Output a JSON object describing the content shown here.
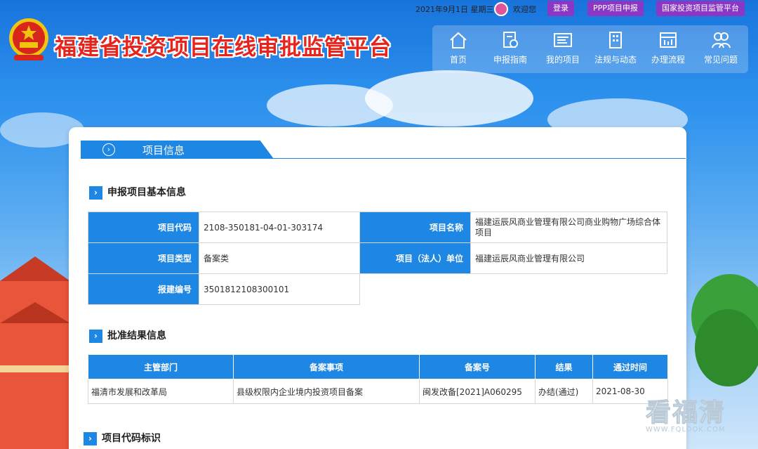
{
  "header": {
    "site_title": "福建省投资项目在线审批监管平台",
    "date_text": "2021年9月1日 星期三",
    "welcome": "欢迎您",
    "login_label": "登录",
    "ppp_label": "PPP项目申报",
    "national_label": "国家投资项目监管平台",
    "nav": [
      {
        "label": "首页",
        "icon": "home-icon"
      },
      {
        "label": "申报指南",
        "icon": "guide-icon"
      },
      {
        "label": "我的项目",
        "icon": "project-icon"
      },
      {
        "label": "法规与动态",
        "icon": "building-icon"
      },
      {
        "label": "办理流程",
        "icon": "process-icon"
      },
      {
        "label": "常见问题",
        "icon": "faq-icon"
      }
    ]
  },
  "panel": {
    "tab_title": "项目信息",
    "basic_section": "申报项目基本信息",
    "basic": {
      "code_label": "项目代码",
      "code_value": "2108-350181-04-01-303174",
      "name_label": "项目名称",
      "name_value": "福建运辰风商业管理有限公司商业购物广场综合体项目",
      "type_label": "项目类型",
      "type_value": "备案类",
      "unit_label": "项目（法人）单位",
      "unit_value": "福建运辰风商业管理有限公司",
      "number_label": "报建编号",
      "number_value": "3501812108300101"
    },
    "result_section": "批准结果信息",
    "result_headers": [
      "主管部门",
      "备案事项",
      "备案号",
      "结果",
      "通过时间"
    ],
    "result_row": [
      "福清市发展和改革局",
      "县级权限内企业境内投资项目备案",
      "闽发改备[2021]A060295",
      "办结(通过)",
      "2021-08-30"
    ],
    "code_section": "项目代码标识"
  },
  "watermark": {
    "big": "看福清",
    "small": "WWW.FQLOOK.COM"
  },
  "colors": {
    "primary": "#1e86e3",
    "pill": "#8b37c6",
    "title_red": "#e8231c"
  }
}
